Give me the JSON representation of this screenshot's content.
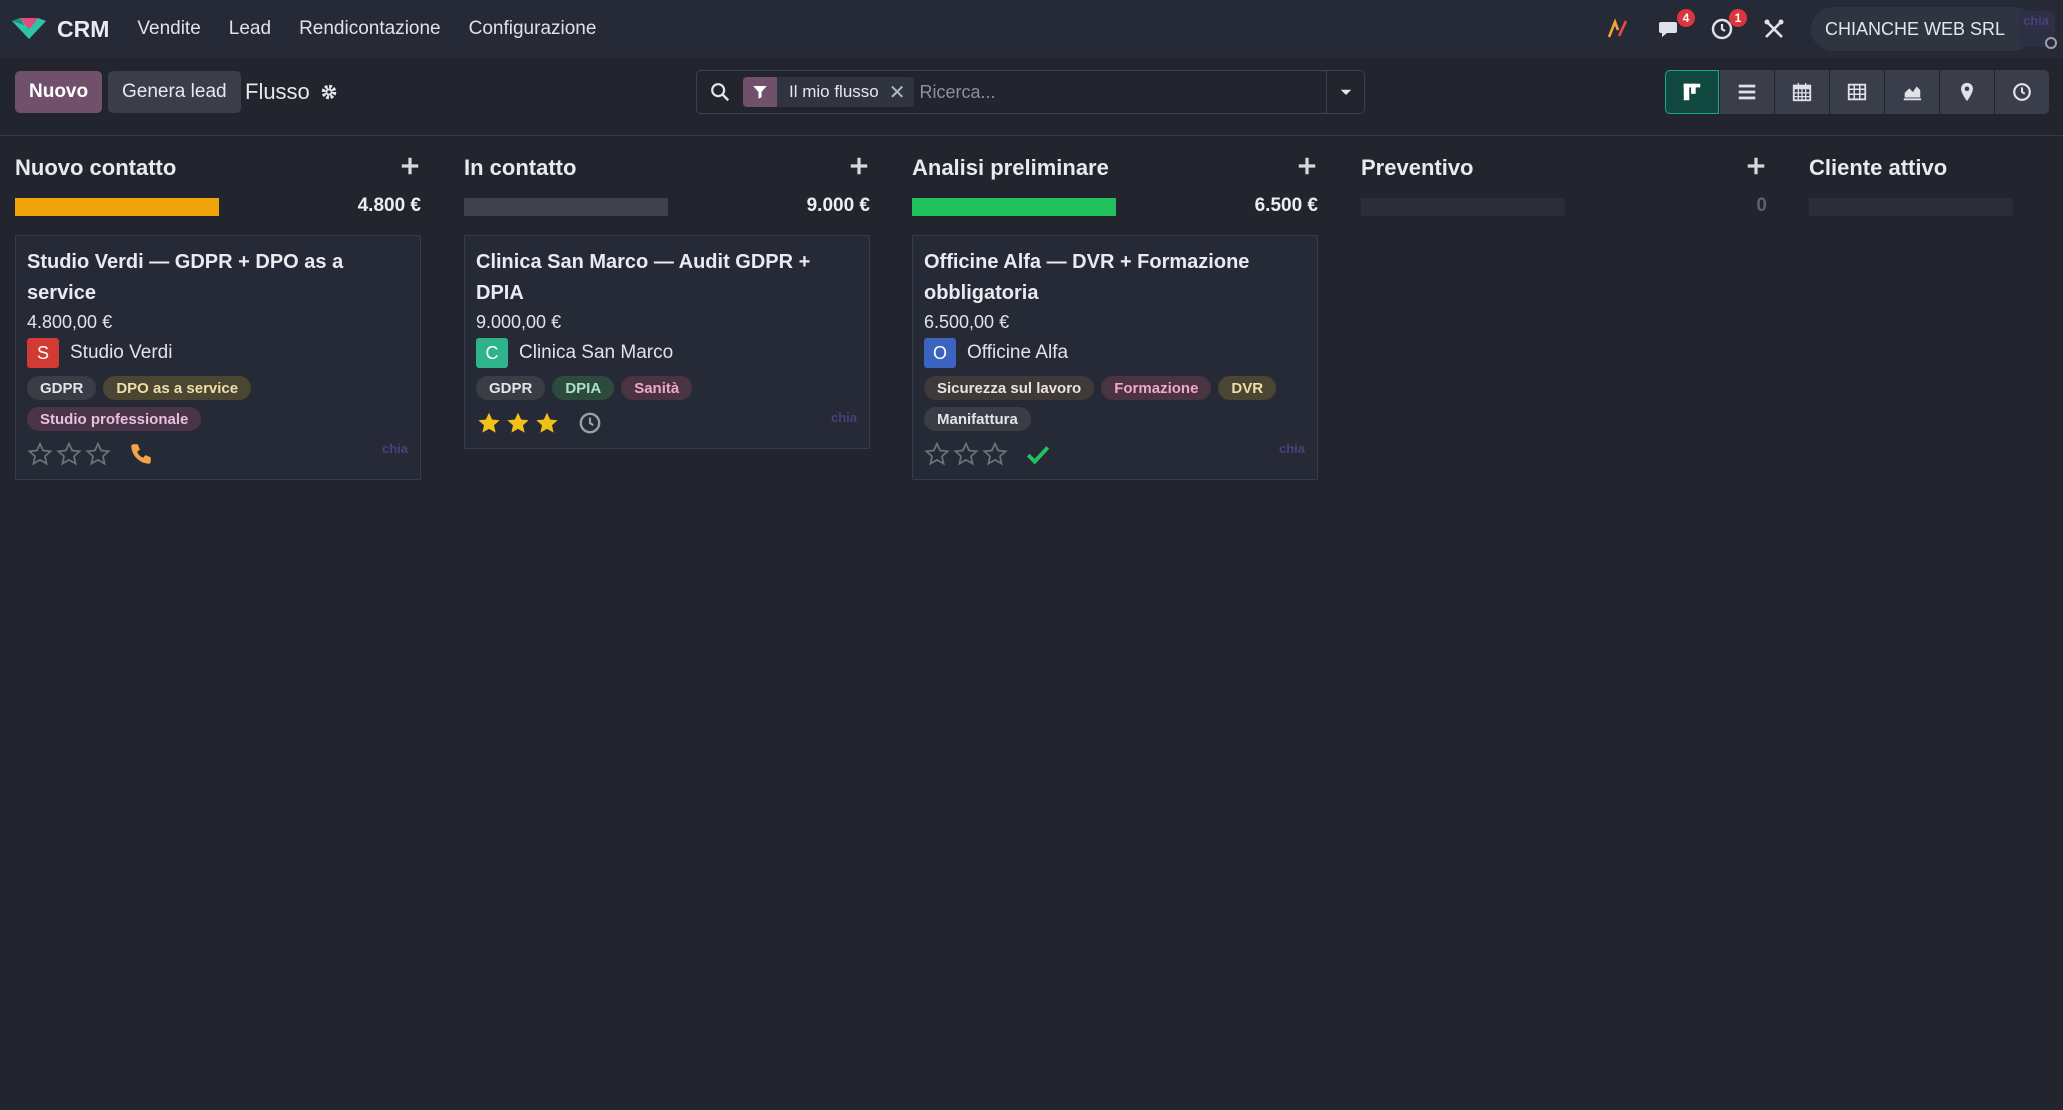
{
  "navbar": {
    "app_name": "CRM",
    "menu": [
      "Vendite",
      "Lead",
      "Rendicontazione",
      "Configurazione"
    ],
    "messages_count": "4",
    "activities_count": "1",
    "company": "CHIANCHE WEB SRL",
    "user_avatar_text": "chia"
  },
  "control": {
    "new_label": "Nuovo",
    "generate_label": "Genera lead",
    "breadcrumb": "Flusso",
    "facet_label": "Il mio flusso",
    "search_placeholder": "Ricerca..."
  },
  "colors": {
    "primary": "#70506a",
    "kanban_active": "#1aa88f",
    "progress_orange": "#f0a30a",
    "progress_green": "#21c25e",
    "star_gold": "#f3c019"
  },
  "columns": [
    {
      "title": "Nuovo contatto",
      "total": "4.800 €",
      "progress_fill": 1.0,
      "progress_color": "#f0a30a",
      "cards": [
        {
          "title": "Studio Verdi — GDPR + DPO as a service",
          "amount": "4.800,00 €",
          "partner_initial": "S",
          "partner_color": "#d23b34",
          "partner": "Studio Verdi",
          "tags": [
            {
              "label": "GDPR",
              "bg": "#3a3d46",
              "fg": "#e2e4e8"
            },
            {
              "label": "DPO as a service",
              "bg": "#4a4631",
              "fg": "#ecdfa9"
            },
            {
              "label": "Studio professionale",
              "bg": "#4a3448",
              "fg": "#e8bfe0"
            }
          ],
          "rating": 0,
          "activity_icon": "phone-icon",
          "user_avatar": "chia"
        }
      ]
    },
    {
      "title": "In contatto",
      "total": "9.000 €",
      "progress_fill": 0,
      "progress_color": "#3e424d",
      "cards": [
        {
          "title": "Clinica San Marco — Audit GDPR + DPIA",
          "amount": "9.000,00 €",
          "partner_initial": "C",
          "partner_color": "#2fb38a",
          "partner": "Clinica San Marco",
          "tags": [
            {
              "label": "GDPR",
              "bg": "#3a3d46",
              "fg": "#e2e4e8"
            },
            {
              "label": "DPIA",
              "bg": "#2d4a3f",
              "fg": "#a9e2c6"
            },
            {
              "label": "Sanità",
              "bg": "#4a3442",
              "fg": "#f0a7c8"
            }
          ],
          "rating": 3,
          "activity_icon": "clock-icon",
          "user_avatar": "chia"
        }
      ]
    },
    {
      "title": "Analisi preliminare",
      "total": "6.500 €",
      "progress_fill": 1.0,
      "progress_color": "#21c25e",
      "cards": [
        {
          "title": "Officine Alfa — DVR + Formazione obbligatoria",
          "amount": "6.500,00 €",
          "partner_initial": "O",
          "partner_color": "#3a64c0",
          "partner": "Officine Alfa",
          "tags": [
            {
              "label": "Sicurezza sul lavoro",
              "bg": "#3f3a3a",
              "fg": "#ece0e0"
            },
            {
              "label": "Formazione",
              "bg": "#4a3442",
              "fg": "#f0a7c8"
            },
            {
              "label": "DVR",
              "bg": "#4a4631",
              "fg": "#ecdfa9"
            },
            {
              "label": "Manifattura",
              "bg": "#3a3d46",
              "fg": "#e2e4e8"
            }
          ],
          "rating": 0,
          "activity_icon": "check-icon",
          "user_avatar": "chia"
        }
      ]
    },
    {
      "title": "Preventivo",
      "total": "0",
      "progress_fill": 0,
      "progress_color": "#2a2e38",
      "cards": []
    },
    {
      "title": "Cliente attivo",
      "total": "",
      "progress_fill": 0,
      "progress_color": "#2a2e38",
      "cards": []
    }
  ]
}
